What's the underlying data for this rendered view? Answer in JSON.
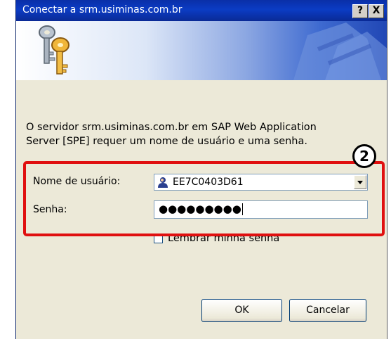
{
  "window": {
    "title": "Conectar a srm.usiminas.com.br",
    "help_label": "?",
    "close_label": "X"
  },
  "banner": {
    "icon": "keys-icon"
  },
  "message": {
    "line1": "O servidor srm.usiminas.com.br em SAP Web Application",
    "line2": "Server [SPE] requer um nome de usuário e uma senha."
  },
  "form": {
    "username_label": "Nome de usuário:",
    "username_value": "EE7C0403D61",
    "password_label": "Senha:",
    "password_mask": "●●●●●●●●●",
    "remember_label": "Lembrar minha senha",
    "remember_checked": false
  },
  "buttons": {
    "ok": "OK",
    "cancel": "Cancelar"
  },
  "annotation": {
    "number": "2",
    "color": "#e01010"
  }
}
